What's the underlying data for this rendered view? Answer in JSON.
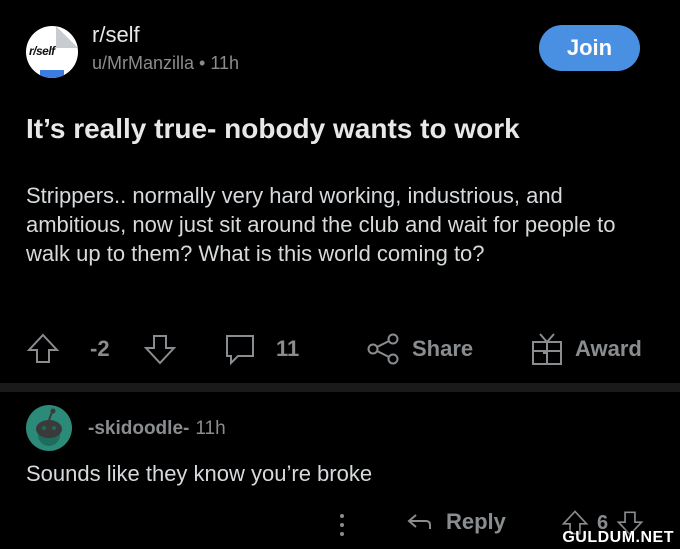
{
  "post": {
    "subreddit": "r/self",
    "icon_text": "r/self",
    "author_line": "u/MrManzilla • 11h",
    "join_label": "Join",
    "title": "It’s really true- nobody wants to work",
    "body": "Strippers..  normally very hard working, industrious, and ambitious, now just sit around the club and wait for people to walk up to them?  What is this world coming to?",
    "score": "-2",
    "comment_count": "11",
    "share_label": "Share",
    "award_label": "Award"
  },
  "comment": {
    "author": "-skidoodle-",
    "time": "11h",
    "text": "Sounds like they know you’re broke",
    "reply_label": "Reply",
    "score": "6"
  },
  "watermark": "GULDUM.NET",
  "colors": {
    "background": "#000000",
    "join": "#4a90e2",
    "muted": "#8a8d90",
    "avatar": "#2c8a78"
  },
  "icons": [
    "subreddit-icon",
    "upvote-icon",
    "downvote-icon",
    "comment-icon",
    "share-icon",
    "award-icon",
    "snoo-avatar-icon",
    "more-icon",
    "reply-icon"
  ]
}
